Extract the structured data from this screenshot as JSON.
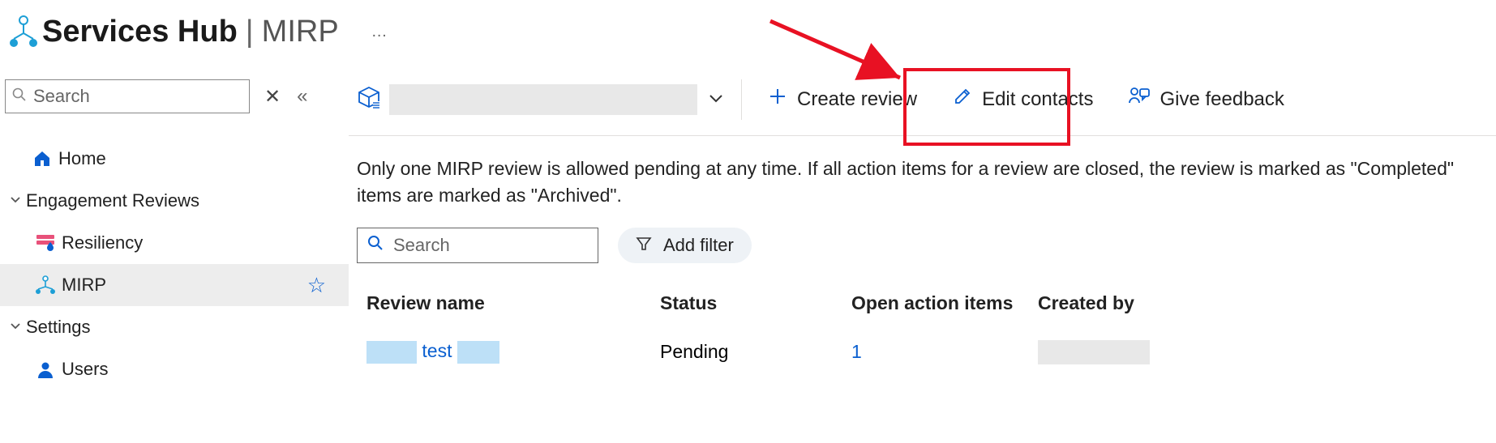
{
  "header": {
    "title": "Services Hub",
    "section": "MIRP",
    "more": "…"
  },
  "sidebar": {
    "search_placeholder": "Search",
    "items": [
      {
        "label": "Home",
        "icon": "home"
      },
      {
        "label": "Engagement Reviews",
        "icon": "chevron-expand"
      },
      {
        "label": "Resiliency",
        "icon": "resiliency",
        "sub": true
      },
      {
        "label": "MIRP",
        "icon": "mirp",
        "sub": true,
        "active": true,
        "starred": true
      },
      {
        "label": "Settings",
        "icon": "chevron-expand"
      },
      {
        "label": "Users",
        "icon": "user",
        "sub": true
      }
    ]
  },
  "toolbar": {
    "create_label": "Create review",
    "edit_label": "Edit contacts",
    "feedback_label": "Give feedback"
  },
  "info_text": "Only one MIRP review is allowed pending at any time. If all action items for a review are closed, the review is marked as \"Completed\" items are marked as \"Archived\".",
  "table": {
    "search_placeholder": "Search",
    "add_filter_label": "Add filter",
    "columns": {
      "name": "Review name",
      "status": "Status",
      "open": "Open action items",
      "created": "Created by"
    },
    "rows": [
      {
        "name_visible": "test",
        "status": "Pending",
        "open": "1"
      }
    ]
  }
}
